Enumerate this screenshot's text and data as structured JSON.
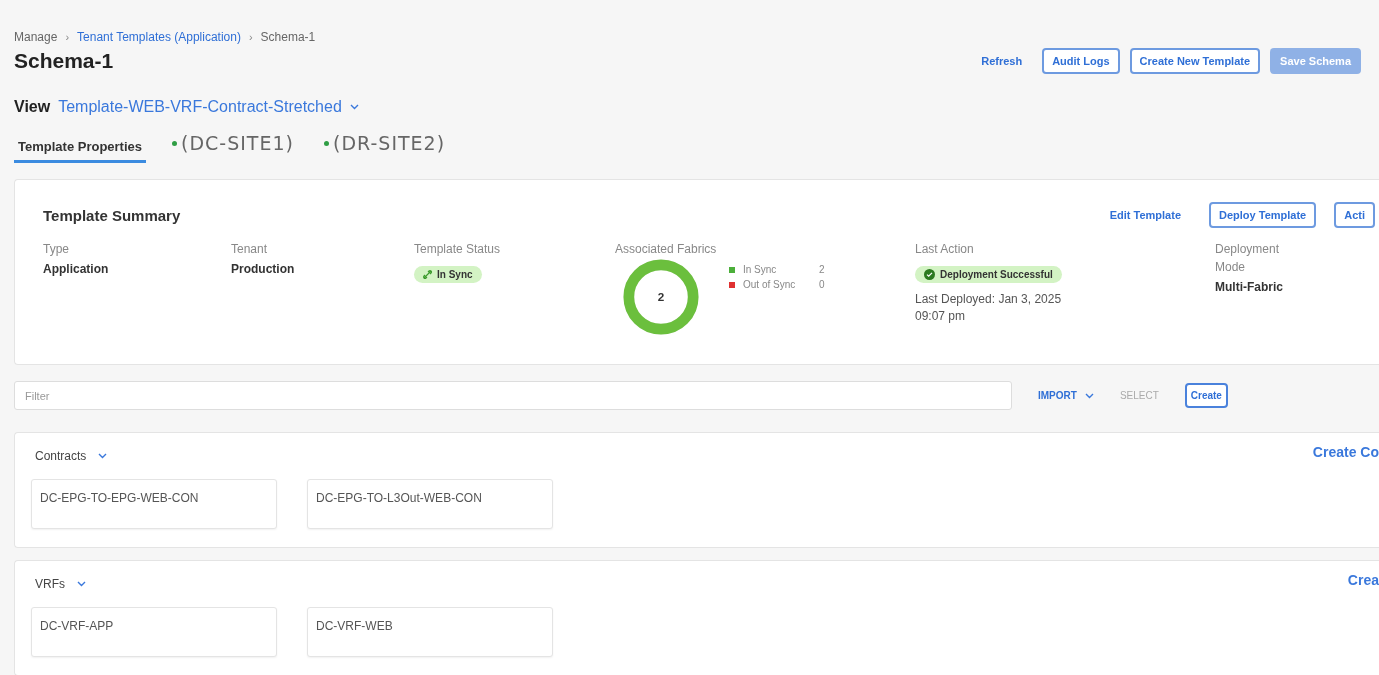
{
  "breadcrumb": [
    {
      "label": "Manage",
      "link": false
    },
    {
      "label": "Tenant Templates (Application)",
      "link": true
    },
    {
      "label": "Schema-1",
      "link": false
    }
  ],
  "breadcrumb_separator": "›",
  "title": "Schema-1",
  "header_actions": [
    {
      "label": "Refresh",
      "kind": "link",
      "disabled": false
    },
    {
      "label": "Audit Logs",
      "kind": "outline",
      "disabled": false
    },
    {
      "label": "Create New Template",
      "kind": "outline",
      "disabled": false
    },
    {
      "label": "Save Schema",
      "kind": "filled",
      "disabled": true
    }
  ],
  "view": {
    "label": "View",
    "value": "Template-WEB-VRF-Contract-Stretched"
  },
  "tabs": [
    {
      "label": "Template Properties",
      "selected": true,
      "kind": "text"
    },
    {
      "label": "(DC-SITE1)",
      "selected": false,
      "kind": "site",
      "color": "#2f9e44"
    },
    {
      "label": "(DR-SITE2)",
      "selected": false,
      "kind": "site",
      "color": "#2f9e44"
    }
  ],
  "summary": {
    "title": "Template Summary",
    "actions": [
      {
        "label": "Edit Template",
        "kind": "link"
      },
      {
        "label": "Deploy Template",
        "kind": "outline"
      },
      {
        "label": "Acti",
        "kind": "outline"
      }
    ],
    "type": {
      "label": "Type",
      "value": "Application"
    },
    "tenant": {
      "label": "Tenant",
      "value": "Production"
    },
    "template_status": {
      "label": "Template Status",
      "value": "In Sync"
    },
    "associated_fabrics": {
      "label": "Associated Fabrics",
      "total": "2",
      "level": 1,
      "legend": [
        {
          "label": "In Sync",
          "count": "2",
          "color": "#4caf3a"
        },
        {
          "label": "Out of Sync",
          "count": "0",
          "color": "#e03131"
        }
      ]
    },
    "last_action": {
      "label": "Last Action",
      "status": "Deployment Successful",
      "detail": "Last Deployed: Jan 3, 2025 09:07 pm"
    },
    "deployment_mode": {
      "label": "Deployment Mode",
      "value": "Multi-Fabric"
    }
  },
  "filter": {
    "placeholder": "Filter"
  },
  "toolbar": [
    {
      "label": "IMPORT",
      "kind": "menu",
      "disabled": false
    },
    {
      "label": "SELECT",
      "kind": "text",
      "disabled": true
    },
    {
      "label": "Create",
      "kind": "outline",
      "disabled": false
    }
  ],
  "sections": [
    {
      "title": "Contracts",
      "action": "Create Co",
      "items": [
        "DC-EPG-TO-EPG-WEB-CON",
        "DC-EPG-TO-L3Out-WEB-CON"
      ]
    },
    {
      "title": "VRFs",
      "action": "Crea",
      "items": [
        "DC-VRF-APP",
        "DC-VRF-WEB"
      ]
    }
  ]
}
